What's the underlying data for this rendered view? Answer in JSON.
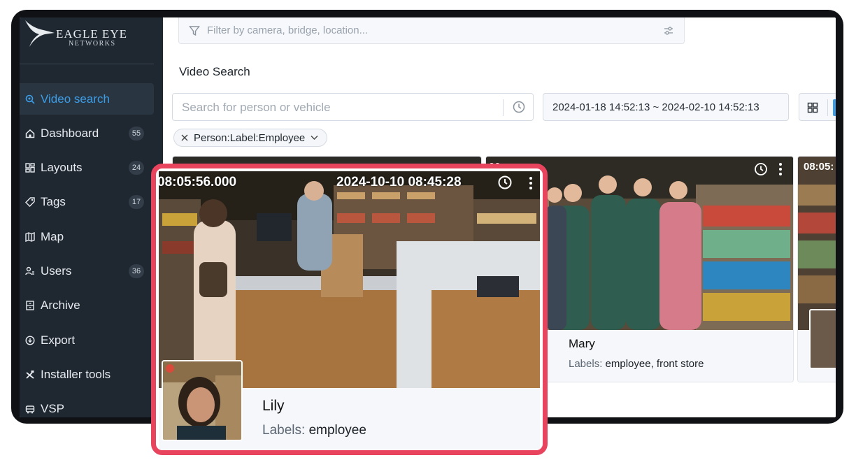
{
  "brand": {
    "name": "EAGLE EYE",
    "sub": "NETWORKS"
  },
  "sidebar": {
    "items": [
      {
        "label": "Video search",
        "icon": "search-icon",
        "badge": "",
        "active": true
      },
      {
        "label": "Dashboard",
        "icon": "home-icon",
        "badge": "55"
      },
      {
        "label": "Layouts",
        "icon": "layouts-icon",
        "badge": "24"
      },
      {
        "label": "Tags",
        "icon": "tag-icon",
        "badge": "17"
      },
      {
        "label": "Map",
        "icon": "map-icon",
        "badge": ""
      },
      {
        "label": "Users",
        "icon": "users-icon",
        "badge": "36"
      },
      {
        "label": "Archive",
        "icon": "archive-icon",
        "badge": ""
      },
      {
        "label": "Export",
        "icon": "export-icon",
        "badge": ""
      },
      {
        "label": "Installer tools",
        "icon": "tools-icon",
        "badge": ""
      },
      {
        "label": "VSP",
        "icon": "vsp-icon",
        "badge": ""
      }
    ]
  },
  "filter": {
    "placeholder": "Filter by camera, bridge, location..."
  },
  "main": {
    "title": "Video Search",
    "search_placeholder": "Search for person or vehicle",
    "date_range": "2024-01-18 14:52:13 ~ 2024-02-10 14:52:13",
    "chip": "Person:Label:Employee"
  },
  "cards": [
    {
      "timestamp": "00",
      "name": "Mary",
      "labels_key": "Labels:",
      "labels_value": "employee, front store"
    },
    {
      "timestamp": "08:05:"
    }
  ],
  "highlight": {
    "timestamp_left": "08:05:56.000",
    "timestamp_right": "2024-10-10 08:45:28",
    "name": "Lily",
    "labels_key": "Labels:",
    "labels_value": "employee"
  },
  "colors": {
    "accent": "#3b9ee8",
    "highlight": "#e8445e",
    "sidebar": "#1f2731"
  }
}
